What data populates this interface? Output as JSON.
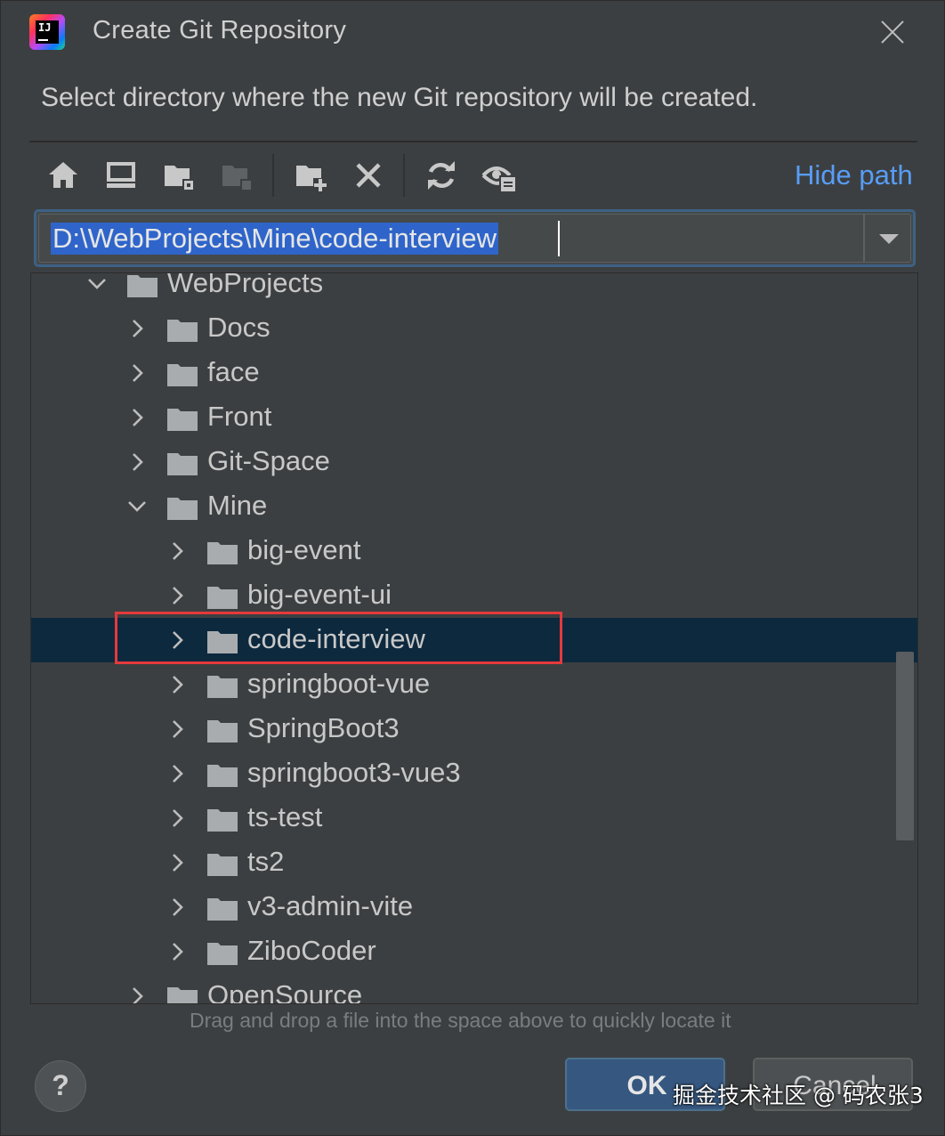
{
  "dialog": {
    "title": "Create Git Repository",
    "description": "Select directory where the new Git repository will be created.",
    "app_icon_text": "IJ"
  },
  "toolbar": {
    "buttons": [
      {
        "icon": "home-icon"
      },
      {
        "icon": "desktop-icon"
      },
      {
        "icon": "project-folder-icon"
      },
      {
        "icon": "module-folder-icon",
        "disabled": true
      },
      {
        "icon": "new-folder-icon"
      },
      {
        "icon": "delete-icon"
      },
      {
        "icon": "refresh-icon"
      },
      {
        "icon": "show-hidden-icon"
      }
    ],
    "hide_path_label": "Hide path"
  },
  "path": {
    "value": "D:\\WebProjects\\Mine\\code-interview"
  },
  "tree": {
    "items": [
      {
        "label": "WebProjects",
        "depth": 0,
        "expanded": true
      },
      {
        "label": "Docs",
        "depth": 1,
        "expanded": false
      },
      {
        "label": "face",
        "depth": 1,
        "expanded": false
      },
      {
        "label": "Front",
        "depth": 1,
        "expanded": false
      },
      {
        "label": "Git-Space",
        "depth": 1,
        "expanded": false
      },
      {
        "label": "Mine",
        "depth": 1,
        "expanded": true
      },
      {
        "label": "big-event",
        "depth": 2,
        "expanded": false
      },
      {
        "label": "big-event-ui",
        "depth": 2,
        "expanded": false
      },
      {
        "label": "code-interview",
        "depth": 2,
        "expanded": false,
        "selected": true
      },
      {
        "label": "springboot-vue",
        "depth": 2,
        "expanded": false
      },
      {
        "label": "SpringBoot3",
        "depth": 2,
        "expanded": false
      },
      {
        "label": "springboot3-vue3",
        "depth": 2,
        "expanded": false
      },
      {
        "label": "ts-test",
        "depth": 2,
        "expanded": false
      },
      {
        "label": "ts2",
        "depth": 2,
        "expanded": false
      },
      {
        "label": "v3-admin-vite",
        "depth": 2,
        "expanded": false
      },
      {
        "label": "ZiboCoder",
        "depth": 2,
        "expanded": false
      },
      {
        "label": "OpenSource",
        "depth": 1,
        "expanded": false
      }
    ]
  },
  "hint": "Drag and drop a file into the space above to quickly locate it",
  "footer": {
    "help_label": "?",
    "ok_label": "OK",
    "cancel_label": "Cancel",
    "watermark": "掘金技术社区 @ 码农张3"
  },
  "colors": {
    "background": "#3c3f41",
    "selection": "#0d293e",
    "accent_link": "#589df6",
    "highlight_box": "#e5393c",
    "ok_button": "#365880"
  }
}
